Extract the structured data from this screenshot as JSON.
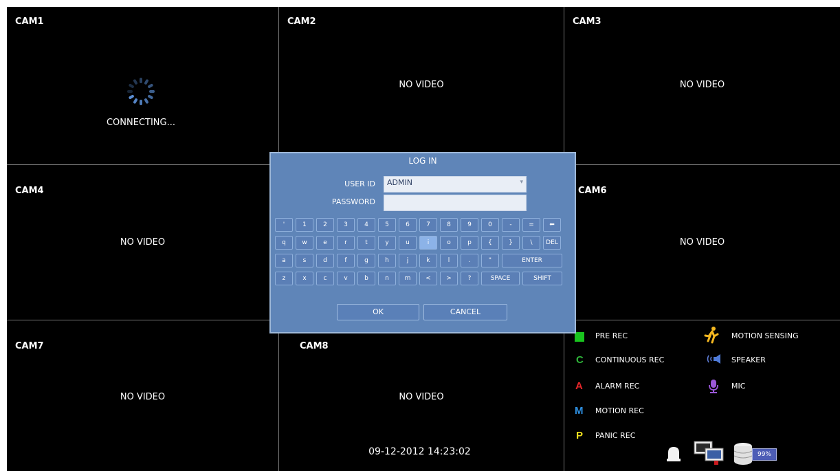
{
  "cams": [
    {
      "label": "CAM1",
      "status": "CONNECTING..."
    },
    {
      "label": "CAM2",
      "status": "NO VIDEO"
    },
    {
      "label": "CAM3",
      "status": "NO VIDEO"
    },
    {
      "label": "CAM4",
      "status": "NO VIDEO"
    },
    {
      "label": "CAM6",
      "status": "NO VIDEO"
    },
    {
      "label": "CAM7",
      "status": "NO VIDEO"
    },
    {
      "label": "CAM8",
      "status": "NO VIDEO"
    }
  ],
  "login": {
    "title": "LOG IN",
    "user_id_label": "USER ID",
    "user_id_value": "ADMIN",
    "password_label": "PASSWORD",
    "password_value": "",
    "keys": [
      [
        "'",
        "1",
        "2",
        "3",
        "4",
        "5",
        "6",
        "7",
        "8",
        "9",
        "0",
        "-",
        "=",
        "⬅"
      ],
      [
        "q",
        "w",
        "e",
        "r",
        "t",
        "y",
        "u",
        "i",
        "o",
        "p",
        "{",
        "}",
        "\\",
        "DEL"
      ],
      [
        "a",
        "s",
        "d",
        "f",
        "g",
        "h",
        "j",
        "k",
        "l",
        ".",
        "\"",
        "ENTER"
      ],
      [
        "z",
        "x",
        "c",
        "v",
        "b",
        "n",
        "m",
        "<",
        ">",
        "?",
        "SPACE",
        "SHIFT"
      ]
    ],
    "highlighted_key": "i",
    "ok_label": "OK",
    "cancel_label": "CANCEL"
  },
  "legend": {
    "pre_rec": "PRE REC",
    "continuous_rec": "CONTINUOUS REC",
    "alarm_rec": "ALARM REC",
    "motion_rec": "MOTION REC",
    "panic_rec": "PANIC REC",
    "motion_sensing": "MOTION SENSING",
    "speaker": "SPEAKER",
    "mic": "MIC",
    "sym_c": "C",
    "sym_a": "A",
    "sym_m": "M",
    "sym_p": "P",
    "colors": {
      "pre": "#19c41e",
      "c": "#2fb53a",
      "a": "#e4262a",
      "m": "#2e8fe0",
      "p": "#f0e01e"
    }
  },
  "datetime": "09-12-2012  14:23:02",
  "hdd_percent": "99%"
}
